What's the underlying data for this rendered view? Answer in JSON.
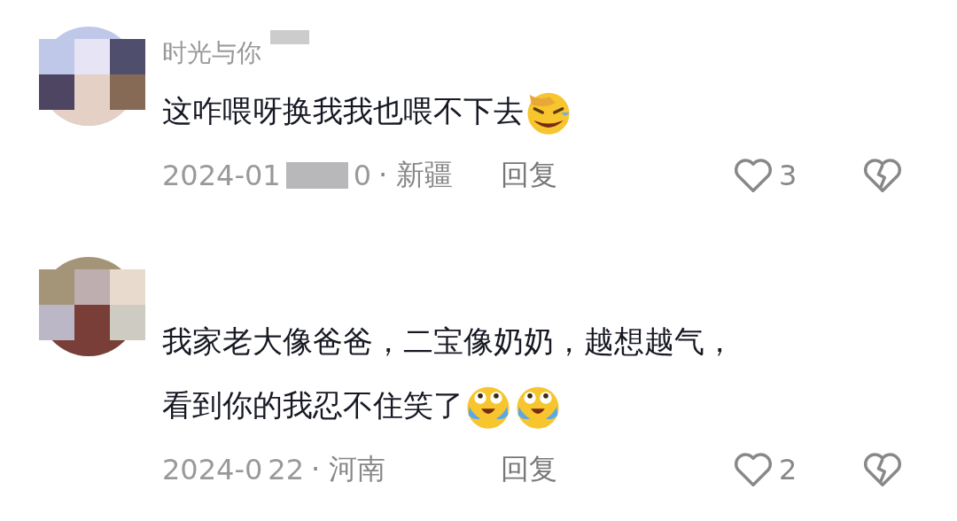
{
  "comments": [
    {
      "avatar": {
        "kind": "picture"
      },
      "username": "时光与你",
      "redacted_name": true,
      "lines": [
        "这咋喂呀换我我也喂不下去"
      ],
      "emojis": [
        {
          "kind": "sweat-laugh"
        }
      ],
      "date": "2024-01",
      "redacted_date": true,
      "date_tail": "0",
      "location": "· 新疆",
      "reply": "回复",
      "likes": "3"
    },
    {
      "avatar": {
        "kind": "picture"
      },
      "redacted_name": false,
      "lines": [
        "我家老大像爸爸，二宝像奶奶，越想越气，",
        "看到你的我忍不住笑了"
      ],
      "emojis": [
        {
          "kind": "tears-joy"
        },
        {
          "kind": "tears-joy"
        }
      ],
      "date": "2024-0",
      "redacted_date": false,
      "date_tail": "22",
      "location": "· 河南",
      "reply": "回复",
      "likes": "2"
    }
  ]
}
